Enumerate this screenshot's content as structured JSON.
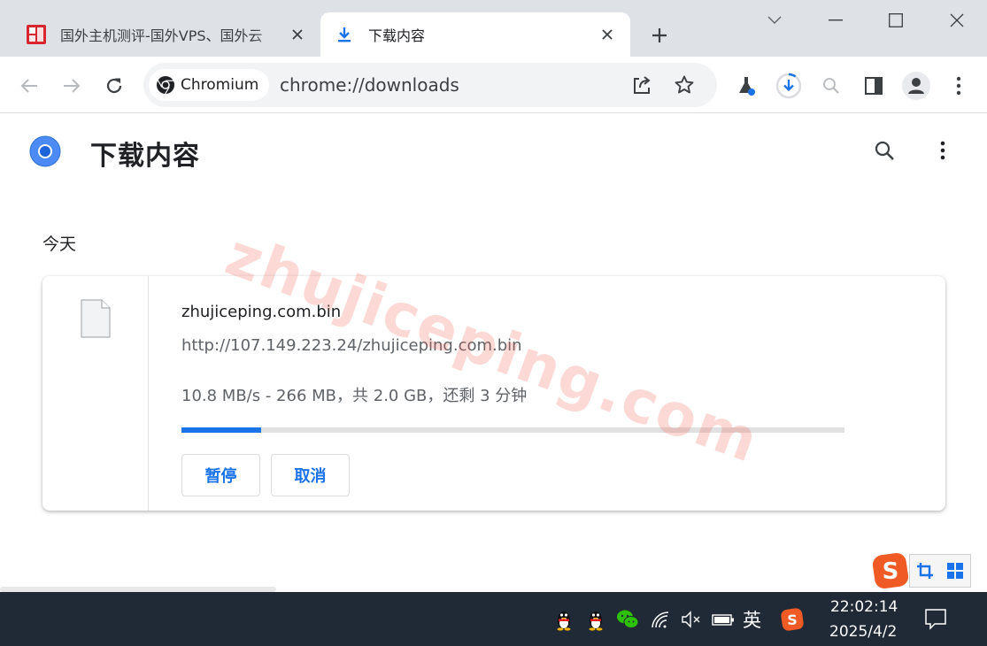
{
  "browser": {
    "tabs": [
      {
        "title": "国外主机测评-国外VPS、国外云",
        "active": false,
        "favicon": "red-seal-favicon"
      },
      {
        "title": "下载内容",
        "active": true,
        "favicon": "download-arrow-icon"
      }
    ],
    "omnibox": {
      "chip_label": "Chromium",
      "url": "chrome://downloads"
    }
  },
  "page": {
    "title": "下载内容",
    "date_heading": "今天",
    "watermark": "zhujiceping.com"
  },
  "download": {
    "file_name": "zhujiceping.com.bin",
    "url": "http://107.149.223.24/zhujiceping.com.bin",
    "status": "10.8 MB/s - 266 MB，共 2.0 GB，还剩 3 分钟",
    "progress_fraction": 0.12,
    "pause_label": "暂停",
    "cancel_label": "取消"
  },
  "taskbar": {
    "ime_label": "英",
    "time": "22:02:14",
    "date": "2025/4/2"
  },
  "colors": {
    "accent": "#1a73e8",
    "tabstrip": "#dee1e6",
    "taskbar": "#202a36"
  }
}
